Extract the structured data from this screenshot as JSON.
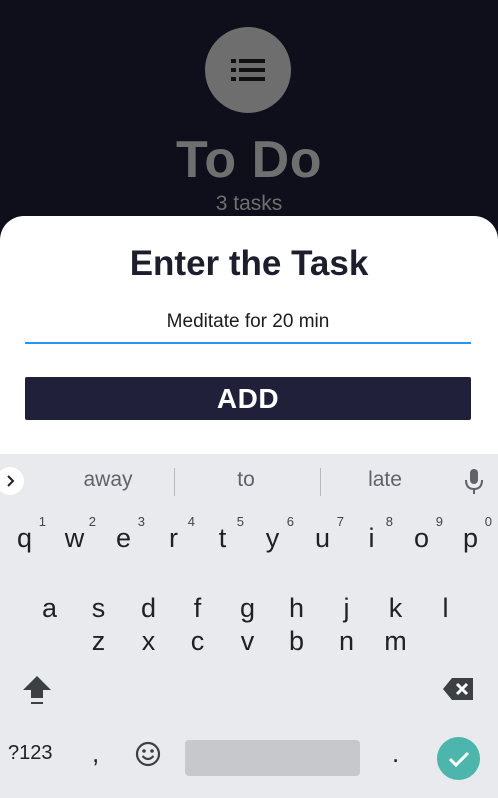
{
  "header": {
    "avatar_icon": "list-icon",
    "title": "To Do",
    "task_count": "3 tasks"
  },
  "dialog": {
    "title": "Enter the Task",
    "input_value": "Meditate for 20 min",
    "add_label": "ADD",
    "accent_color": "#2196f3",
    "button_color": "#20203a"
  },
  "keyboard": {
    "suggestions": [
      "away",
      "to",
      "late"
    ],
    "row1": [
      {
        "key": "q",
        "hint": "1"
      },
      {
        "key": "w",
        "hint": "2"
      },
      {
        "key": "e",
        "hint": "3"
      },
      {
        "key": "r",
        "hint": "4"
      },
      {
        "key": "t",
        "hint": "5"
      },
      {
        "key": "y",
        "hint": "6"
      },
      {
        "key": "u",
        "hint": "7"
      },
      {
        "key": "i",
        "hint": "8"
      },
      {
        "key": "o",
        "hint": "9"
      },
      {
        "key": "p",
        "hint": "0"
      }
    ],
    "row2": [
      "a",
      "s",
      "d",
      "f",
      "g",
      "h",
      "j",
      "k",
      "l"
    ],
    "row3": [
      "z",
      "x",
      "c",
      "v",
      "b",
      "n",
      "m"
    ],
    "symbols_label": "?123",
    "comma": ",",
    "period": ".",
    "enter_color": "#4db6ac"
  }
}
